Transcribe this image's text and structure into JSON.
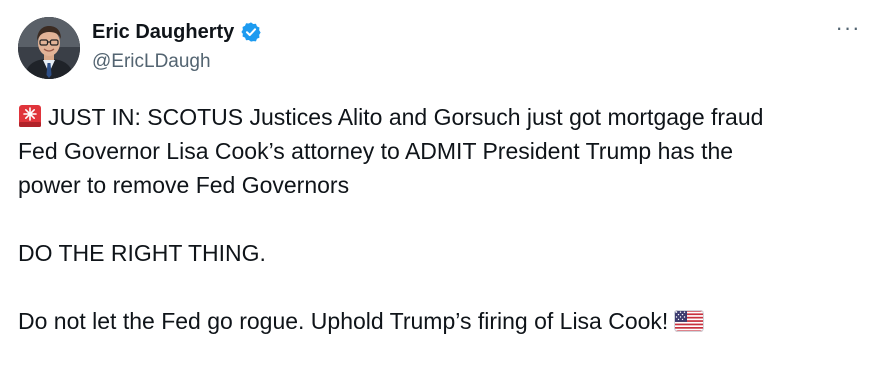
{
  "author": {
    "display_name": "Eric Daugherty",
    "handle": "@EricLDaugh",
    "verified": true,
    "verified_badge_color": "#1d9bf0",
    "avatar_icon": "person-photo"
  },
  "menu": {
    "more_icon": "more-horizontal-icon",
    "label": "···"
  },
  "tweet": {
    "emoji_start": "siren-emoji",
    "line1": "JUST IN: SCOTUS Justices Alito and Gorsuch just got mortgage fraud",
    "line2": "Fed Governor Lisa Cook’s attorney to ADMIT President Trump has the",
    "line3": "power to remove Fed Governors",
    "line4": "DO THE RIGHT THING.",
    "line5": "Do not let the Fed go rogue. Uphold Trump’s firing of Lisa Cook!",
    "emoji_end": "us-flag-emoji"
  },
  "colors": {
    "text": "#0f1419",
    "secondary": "#536471",
    "background": "#ffffff"
  }
}
